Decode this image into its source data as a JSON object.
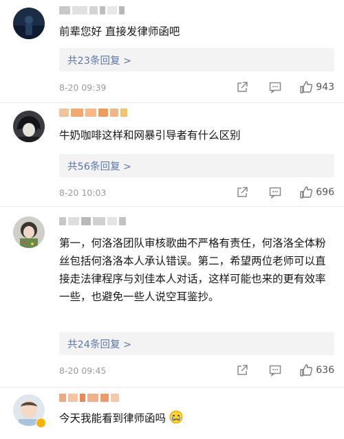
{
  "comments": [
    {
      "text": "前辈您好 直接发律师函吧",
      "replies_label": "共23条回复 >",
      "time": "8-20 09:39",
      "likes": "943",
      "icons": [
        "share-icon",
        "comment-icon",
        "like-icon"
      ]
    },
    {
      "text": "牛奶咖啡这样和网暴引导者有什么区别",
      "replies_label": "共56条回复 >",
      "time": "8-20 10:03",
      "likes": "696",
      "icons": [
        "share-icon",
        "comment-icon",
        "like-icon"
      ]
    },
    {
      "text": "第一，何洛洛团队审核歌曲不严格有责任，何洛洛全体粉丝包括何洛洛本人承认错误。第二，希望两位老师可以直接走法律程序与刘佳本人对话，这样可能也来的更有效率一些，也避免一些人说空耳鉴抄。",
      "replies_label": "共24条回复 >",
      "time": "8-20 09:45",
      "likes": "636",
      "icons": [
        "share-icon",
        "comment-icon",
        "like-icon"
      ]
    },
    {
      "text": "今天我能看到律师函吗",
      "emoji": "crying-face-icon",
      "icons": []
    }
  ],
  "colors": {
    "reply_link": "#5b77a8",
    "meta_gray": "#9a9a9a",
    "reply_bg": "#f3f3f3"
  }
}
